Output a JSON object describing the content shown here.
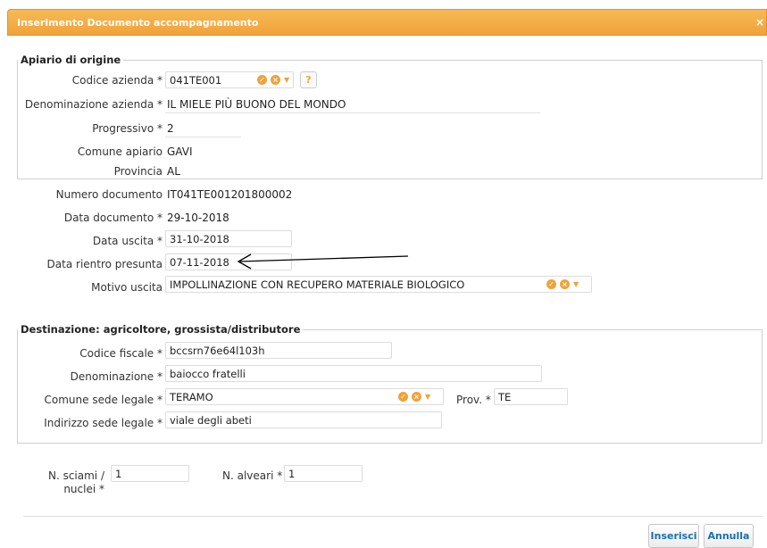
{
  "dialog": {
    "title": "Inserimento Documento accompagnamento",
    "close_label": "×"
  },
  "origine": {
    "legend": "Apiario di origine",
    "codice_azienda_label": "Codice azienda *",
    "codice_azienda_value": "041TE001",
    "help_label": "?",
    "denominazione_label": "Denominazione azienda *",
    "denominazione_value": "IL MIELE PIÙ BUONO DEL MONDO",
    "progressivo_label": "Progressivo *",
    "progressivo_value": "2",
    "comune_label": "Comune apiario",
    "comune_value": "GAVI",
    "provincia_label": "Provincia",
    "provincia_value": "AL"
  },
  "documento": {
    "numero_label": "Numero documento",
    "numero_value": "IT041TE001201800002",
    "data_doc_label": "Data documento *",
    "data_doc_value": "29-10-2018",
    "data_uscita_label": "Data uscita *",
    "data_uscita_value": "31-10-2018",
    "data_rientro_label": "Data rientro presunta",
    "data_rientro_value": "07-11-2018",
    "motivo_label": "Motivo uscita",
    "motivo_value": "IMPOLLINAZIONE CON RECUPERO MATERIALE BIOLOGICO"
  },
  "destinazione": {
    "legend": "Destinazione: agricoltore, grossista/distributore",
    "cf_label": "Codice fiscale *",
    "cf_value": "bccsrn76e64l103h",
    "denom_label": "Denominazione *",
    "denom_value": "baiocco fratelli",
    "comune_label": "Comune sede legale *",
    "comune_value": "TERAMO",
    "prov_label": "Prov. *",
    "prov_value": "TE",
    "indirizzo_label": "Indirizzo sede legale *",
    "indirizzo_value": "viale degli abeti"
  },
  "quantita": {
    "sciami_label_line1": "N. sciami /",
    "sciami_label_line2": "nuclei *",
    "sciami_value": "1",
    "alveari_label": "N. alveari *",
    "alveari_value": "1"
  },
  "buttons": {
    "inserisci": "Inserisci",
    "annulla": "Annulla"
  },
  "colors": {
    "accent": "#f0a23a",
    "button_text": "#1a6fb0"
  }
}
